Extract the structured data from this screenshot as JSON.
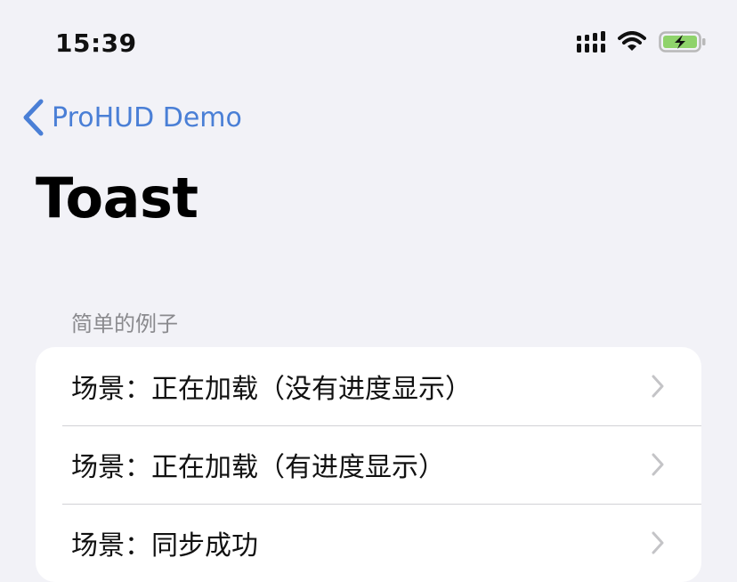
{
  "status_bar": {
    "time": "15:39",
    "icons": [
      "cellular-signal-icon",
      "wifi-icon",
      "battery-charging-icon"
    ]
  },
  "nav": {
    "back_label": "ProHUD Demo",
    "title": "Toast"
  },
  "section": {
    "header": "简单的例子",
    "items": [
      {
        "label": "场景：正在加载（没有进度显示）"
      },
      {
        "label": "场景：正在加载（有进度显示）"
      },
      {
        "label": "场景：同步成功"
      }
    ]
  },
  "colors": {
    "accent": "#4a7fd6",
    "background": "#f2f2f7",
    "cell_background": "#ffffff",
    "separator": "#d1d1d6",
    "secondary_text": "#8a8a8e",
    "battery_fill": "#8fd36b"
  }
}
